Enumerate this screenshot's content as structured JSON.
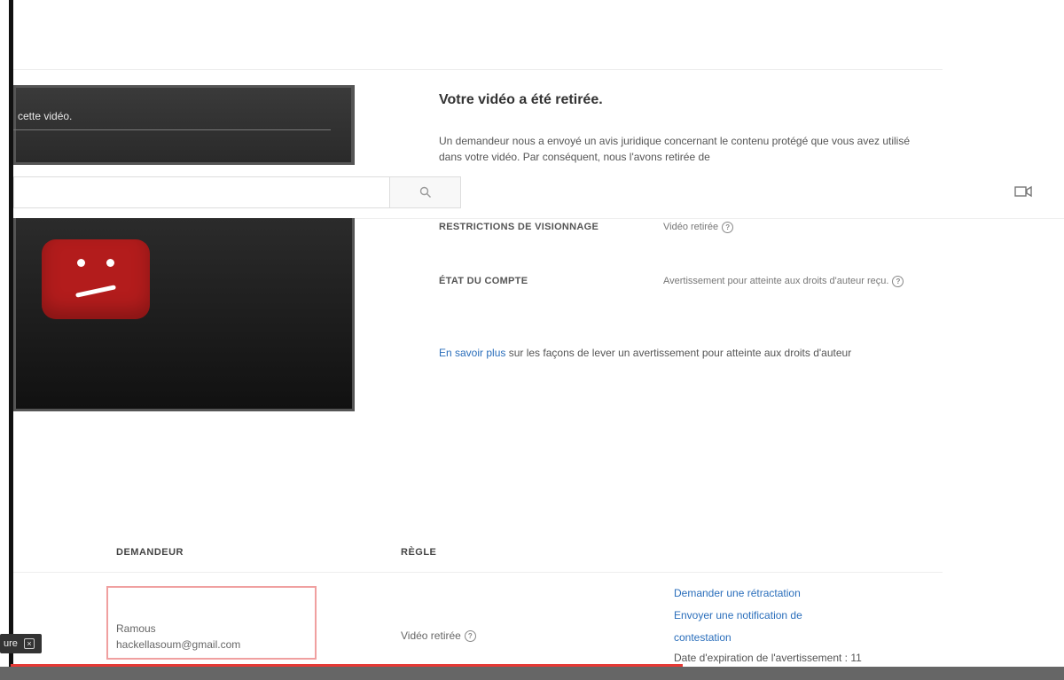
{
  "video": {
    "caption": "cette vidéo."
  },
  "search": {
    "placeholder": ""
  },
  "notice": {
    "title": "Votre vidéo a été retirée.",
    "body": "Un demandeur nous a envoyé un avis juridique concernant le contenu protégé que vous avez utilisé dans votre vidéo. Par conséquent, nous l'avons retirée de"
  },
  "details": {
    "restrictions_label": "RESTRICTIONS DE VISIONNAGE",
    "restrictions_value": "Vidéo retirée",
    "account_label": "ÉTAT DU COMPTE",
    "account_value": "Avertissement pour atteinte aux droits d'auteur reçu."
  },
  "learn_more": {
    "link": "En savoir plus",
    "text": " sur les façons de lever un avertissement pour atteinte aux droits d'auteur"
  },
  "table": {
    "headers": {
      "requester": "DEMANDEUR",
      "rule": "RÈGLE"
    },
    "row": {
      "requester_name": "Ramous",
      "requester_email": "hackellasoum@gmail.com",
      "rule": "Vidéo retirée",
      "actions": [
        "Demander une rétractation",
        "Envoyer une notification de",
        "contestation"
      ],
      "expiry": "Date d'expiration de l'avertissement : 11"
    }
  },
  "player": {
    "close_label": "ure"
  },
  "colors": {
    "link": "#2a6ebb",
    "error_red": "#b31c1c",
    "progress": "#e53935"
  },
  "icons": {
    "search": "search-icon",
    "camera": "video-camera-icon",
    "info": "info-icon",
    "error": "sad-face-error-icon"
  }
}
